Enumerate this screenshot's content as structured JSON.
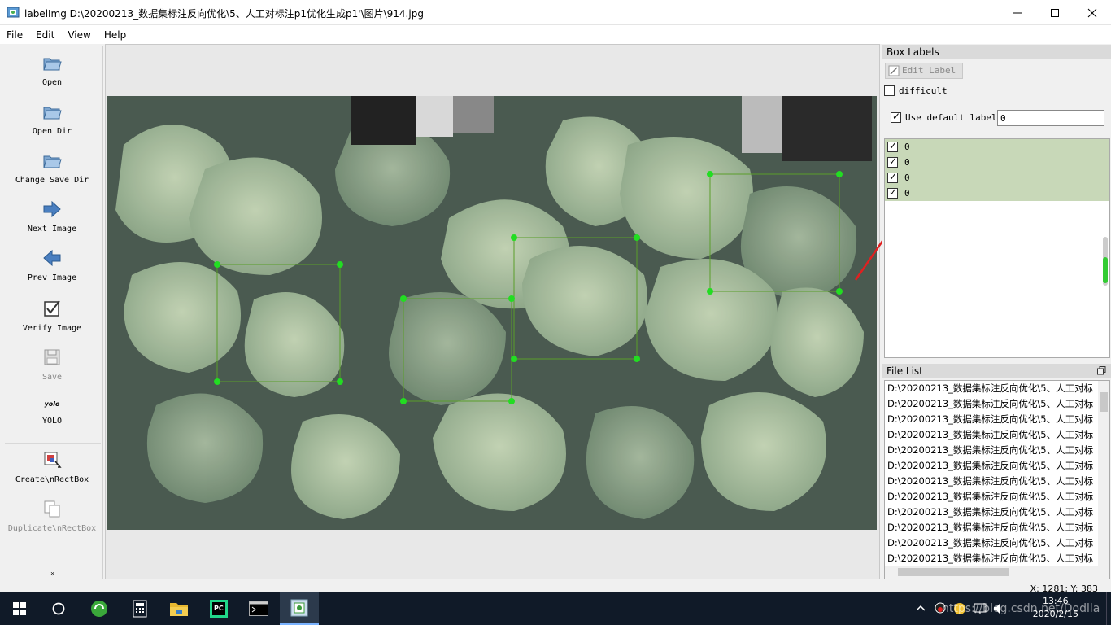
{
  "window": {
    "title": "labelImg D:\\20200213_数据集标注反向优化\\5、人工对标注p1优化生成p1'\\图片\\914.jpg"
  },
  "menu": {
    "file": "File",
    "edit": "Edit",
    "view": "View",
    "help": "Help"
  },
  "toolbar": {
    "open": "Open",
    "open_dir": "Open Dir",
    "change_save_dir": "Change Save Dir",
    "next_image": "Next Image",
    "prev_image": "Prev Image",
    "verify_image": "Verify Image",
    "save": "Save",
    "yolo_icon": "yolo",
    "yolo": "YOLO",
    "create_rect": "Create\\nRectBox",
    "duplicate_rect": "Duplicate\\nRectBox",
    "more": "»"
  },
  "box_labels": {
    "title": "Box Labels",
    "edit_label": "Edit Label",
    "difficult": "difficult",
    "use_default_label": "Use default label",
    "default_label_value": "0",
    "labels": [
      "0",
      "0",
      "0",
      "0"
    ]
  },
  "file_list": {
    "title": "File List",
    "items": [
      "D:\\20200213_数据集标注反向优化\\5、人工对标",
      "D:\\20200213_数据集标注反向优化\\5、人工对标",
      "D:\\20200213_数据集标注反向优化\\5、人工对标",
      "D:\\20200213_数据集标注反向优化\\5、人工对标",
      "D:\\20200213_数据集标注反向优化\\5、人工对标",
      "D:\\20200213_数据集标注反向优化\\5、人工对标",
      "D:\\20200213_数据集标注反向优化\\5、人工对标",
      "D:\\20200213_数据集标注反向优化\\5、人工对标",
      "D:\\20200213_数据集标注反向优化\\5、人工对标",
      "D:\\20200213_数据集标注反向优化\\5、人工对标",
      "D:\\20200213_数据集标注反向优化\\5、人工对标",
      "D:\\20200213_数据集标注反向优化\\5、人工对标"
    ]
  },
  "status": {
    "coords": "X: 1281; Y: 383"
  },
  "taskbar": {
    "time": "13:46",
    "date": "2020/2/15",
    "watermark": "https://blog.csdn.net/Dodlla"
  },
  "colors": {
    "label_bg": "#c8d8b8",
    "box_stroke": "#5a9e2a",
    "box_handle": "#22dd22",
    "arrow": "#e02020"
  }
}
